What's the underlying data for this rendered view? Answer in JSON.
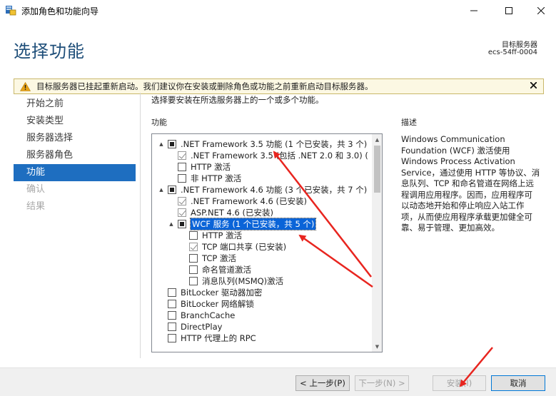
{
  "window": {
    "title": "添加角色和功能向导",
    "minimize_glyph": "—",
    "maximize_glyph": "☐",
    "close_glyph": "✕"
  },
  "header": {
    "page_title": "选择功能",
    "server_label": "目标服务器",
    "server_name": "ecs-54ff-0004"
  },
  "warning": {
    "text": "目标服务器已挂起重新启动。我们建议你在安装或删除角色或功能之前重新启动目标服务器。",
    "close_glyph": "✕",
    "colors": {
      "background": "#fcf8e3",
      "icon": "#e8a317"
    }
  },
  "nav": {
    "items": [
      {
        "label": "开始之前",
        "state": "normal"
      },
      {
        "label": "安装类型",
        "state": "normal"
      },
      {
        "label": "服务器选择",
        "state": "normal"
      },
      {
        "label": "服务器角色",
        "state": "normal"
      },
      {
        "label": "功能",
        "state": "active"
      },
      {
        "label": "确认",
        "state": "disabled"
      },
      {
        "label": "结果",
        "state": "disabled"
      }
    ],
    "colors": {
      "active_bg": "#1e6ec0"
    }
  },
  "main": {
    "instruction": "选择要安装在所选服务器上的一个或多个功能。",
    "features_label": "功能",
    "description_label": "描述",
    "description_text": "Windows Communication Foundation (WCF) 激活使用 Windows Process Activation Service，通过使用 HTTP 等协议、消息队列、TCP 和命名管道在网络上远程调用应用程序。因而，应用程序可以动态地开始和停止响应入站工作项，从而使应用程序承载更加健全可靠、易于管理、更加高效。",
    "tree": [
      {
        "label": ".NET Framework 3.5 功能 (1 个已安装，共 3 个)",
        "level": 0,
        "expander": "▲",
        "checkbox": "partial",
        "selected": false
      },
      {
        "label": ".NET Framework 3.5 (包括 .NET 2.0 和 3.0) (",
        "level": 1,
        "expander": "",
        "checkbox": "checked-grey",
        "selected": false
      },
      {
        "label": "HTTP 激活",
        "level": 1,
        "expander": "",
        "checkbox": "empty",
        "selected": false
      },
      {
        "label": "非 HTTP 激活",
        "level": 1,
        "expander": "",
        "checkbox": "empty",
        "selected": false
      },
      {
        "label": ".NET Framework 4.6 功能 (3 个已安装，共 7 个)",
        "level": 0,
        "expander": "▲",
        "checkbox": "partial",
        "selected": false
      },
      {
        "label": ".NET Framework 4.6 (已安装)",
        "level": 1,
        "expander": "",
        "checkbox": "checked-grey",
        "selected": false
      },
      {
        "label": "ASP.NET 4.6 (已安装)",
        "level": 1,
        "expander": "",
        "checkbox": "checked-grey",
        "selected": false
      },
      {
        "label": "WCF 服务 (1 个已安装，共 5 个)",
        "level": 1,
        "expander": "▲",
        "checkbox": "partial",
        "selected": true
      },
      {
        "label": "HTTP 激活",
        "level": 2,
        "expander": "",
        "checkbox": "empty",
        "selected": false
      },
      {
        "label": "TCP 端口共享 (已安装)",
        "level": 2,
        "expander": "",
        "checkbox": "checked-grey",
        "selected": false
      },
      {
        "label": "TCP 激活",
        "level": 2,
        "expander": "",
        "checkbox": "empty",
        "selected": false
      },
      {
        "label": "命名管道激活",
        "level": 2,
        "expander": "",
        "checkbox": "empty",
        "selected": false
      },
      {
        "label": "消息队列(MSMQ)激活",
        "level": 2,
        "expander": "",
        "checkbox": "empty",
        "selected": false
      },
      {
        "label": "BitLocker 驱动器加密",
        "level": 0,
        "expander": "",
        "checkbox": "empty",
        "selected": false
      },
      {
        "label": "BitLocker 网络解锁",
        "level": 0,
        "expander": "",
        "checkbox": "empty",
        "selected": false
      },
      {
        "label": "BranchCache",
        "level": 0,
        "expander": "",
        "checkbox": "empty",
        "selected": false
      },
      {
        "label": "DirectPlay",
        "level": 0,
        "expander": "",
        "checkbox": "empty",
        "selected": false
      },
      {
        "label": "HTTP 代理上的 RPC",
        "level": 0,
        "expander": "",
        "checkbox": "empty",
        "selected": false
      }
    ],
    "scroll": {
      "up_glyph": "▲",
      "down_glyph": "▼"
    }
  },
  "footer": {
    "prev_label": "< 上一步(P)",
    "next_label": "下一步(N) >",
    "install_label": "安装(I)",
    "cancel_label": "取消"
  },
  "annotation_color": "#e8251f"
}
